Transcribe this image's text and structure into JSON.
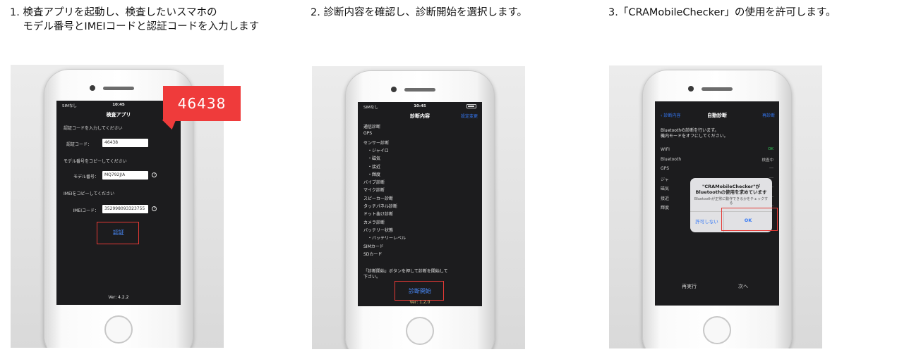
{
  "steps": [
    {
      "caption": "1. 検査アプリを起動し、検査したいスマホの\n    モデル番号とIMEIコードと認証コードを入力します",
      "screen": {
        "carrier": "SIMなし",
        "time": "10:45",
        "title": "検査アプリ",
        "auth_prompt": "認証コードを入力してください",
        "auth_label": "認証コード：",
        "auth_value": "46438",
        "model_prompt": "モデル番号をコピーしてください",
        "model_label": "モデル番号：",
        "model_value": "MQ792J/A",
        "imei_prompt": "IMEIをコピーしてください",
        "imei_label": "IMEIコード：",
        "imei_value": "352998093323755",
        "help_glyph": "?",
        "submit_label": "認証",
        "version": "Ver: 4.2.2"
      },
      "callout": "46438"
    },
    {
      "caption": "2. 診断内容を確認し、診断開始を選択します。",
      "screen": {
        "carrier": "SIMなし",
        "time": "10:45",
        "title": "診断内容",
        "right_action": "設定変更",
        "items": [
          "通信診断",
          "GPS",
          "センサー診断",
          "・ジャイロ",
          "・磁気",
          "・接近",
          "・輝度",
          "バイブ診断",
          "マイク診断",
          "スピーカー診断",
          "タッチパネル診断",
          "ドット抜け診断",
          "カメラ診断",
          "バッテリー状態",
          "・バッテリーレベル",
          "SIMカード",
          "SDカード"
        ],
        "instruction": "「診断開始」ボタンを押して診断を開始して\n下さい。",
        "start_label": "診断開始",
        "version": "Ver: 1.2.0"
      }
    },
    {
      "caption": "3.「CRAMobileChecker」の使用を許可します。",
      "screen": {
        "back_label": "診断内容",
        "title": "自動診断",
        "right_action": "再診断",
        "intro": "Bluetoothの診断を行います。\n機内モードをオフにしてください。",
        "rows": [
          {
            "label": "WIFI",
            "value": "OK",
            "status": "ok"
          },
          {
            "label": "Bluetooth",
            "value": "検査中",
            "status": "pending"
          },
          {
            "label": "GPS",
            "value": "---",
            "status": "none"
          },
          {
            "label": "ジャ",
            "value": "---",
            "status": "none"
          },
          {
            "label": "磁気",
            "value": "---",
            "status": "none"
          },
          {
            "label": "接近",
            "value": "---",
            "status": "none"
          },
          {
            "label": "輝度",
            "value": "---",
            "status": "none"
          }
        ],
        "dialog": {
          "title": "\"CRAMobileChecker\"が\nBluetoothの使用を求めています",
          "message": "Bluetoothが正常に動作できるかをチェックする",
          "deny_label": "許可しない",
          "ok_label": "OK"
        },
        "retry_label": "再実行",
        "next_label": "次へ"
      }
    }
  ],
  "colors": {
    "highlight": "#e53935",
    "callout": "#ef3b3b",
    "ios_blue": "#3478f6",
    "ok_green": "#34c759"
  }
}
